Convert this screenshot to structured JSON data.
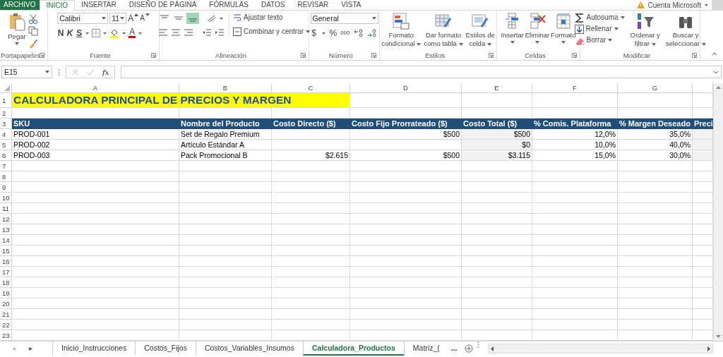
{
  "ribbon": {
    "tabs": [
      {
        "label": "ARCHIVO",
        "kind": "file",
        "selected": false
      },
      {
        "label": "INICIO",
        "kind": "tab",
        "selected": true
      },
      {
        "label": "INSERTAR",
        "kind": "tab",
        "selected": false
      },
      {
        "label": "DISEÑO DE PÁGINA",
        "kind": "tab",
        "selected": false
      },
      {
        "label": "FÓRMULAS",
        "kind": "tab",
        "selected": false
      },
      {
        "label": "DATOS",
        "kind": "tab",
        "selected": false
      },
      {
        "label": "REVISAR",
        "kind": "tab",
        "selected": false
      },
      {
        "label": "VISTA",
        "kind": "tab",
        "selected": false
      }
    ],
    "account": "Cuenta Microsoft",
    "clipboard": {
      "label": "Portapapeles",
      "paste": "Pegar"
    },
    "font": {
      "label": "Fuente",
      "font_name": "Calibri",
      "font_size": "11",
      "grow": "A",
      "shrink": "A",
      "bold": "N",
      "italic": "K",
      "underline": "S",
      "font_color": "A"
    },
    "alignment": {
      "label": "Alineación",
      "vertical": [
        {
          "selected": false
        },
        {
          "selected": false
        },
        {
          "selected": true
        }
      ],
      "wrap": "Ajustar texto",
      "merge": "Combinar y centrar"
    },
    "number": {
      "label": "Número",
      "format": "General",
      "currency": "$",
      "percent": "%",
      "thousands": "000"
    },
    "styles": {
      "label": "Estilos",
      "buttons": [
        {
          "lines": [
            "Formato",
            "condicional"
          ]
        },
        {
          "lines": [
            "Dar formato",
            "como tabla"
          ]
        },
        {
          "lines": [
            "Estilos de",
            "celda"
          ]
        }
      ]
    },
    "cells": {
      "label": "Celdas",
      "buttons": [
        "Insertar",
        "Eliminar",
        "Formato"
      ]
    },
    "editing": {
      "label": "Modificar",
      "small": [
        "Autosuma",
        "Rellenar",
        "Borrar"
      ],
      "large": [
        {
          "lines": [
            "Ordenar y",
            "filtrar"
          ]
        },
        {
          "lines": [
            "Buscar y",
            "seleccionar"
          ]
        }
      ]
    }
  },
  "formula_bar": {
    "name_box": "E15",
    "function_symbol": "fx"
  },
  "sheet": {
    "columns": [
      {
        "letter": "A",
        "shaded": false
      },
      {
        "letter": "B",
        "shaded": false
      },
      {
        "letter": "C",
        "shaded": false
      },
      {
        "letter": "D",
        "shaded": false
      },
      {
        "letter": "E",
        "shaded": true
      },
      {
        "letter": "F",
        "shaded": false
      },
      {
        "letter": "G",
        "shaded": false
      },
      {
        "shaded": true
      }
    ],
    "rows": [
      {
        "number": "1",
        "kind": "title",
        "cells": [
          "CALCULADORA PRINCIPAL DE PRECIOS Y MARGEN"
        ]
      },
      {
        "number": "2",
        "kind": "blank"
      },
      {
        "number": "3",
        "kind": "header",
        "cells": [
          "SKU",
          "Nombre del Producto",
          "Costo Directo ($)",
          "Costo Fijo Prorrateado ($)",
          "Costo Total ($)",
          "% Comis. Plataforma",
          "% Margen Deseado",
          "Preci"
        ]
      },
      {
        "number": "4",
        "kind": "data",
        "cells": [
          "PROD-001",
          "Set de Regalo Premium",
          null,
          "$500",
          "$500",
          "12,0%",
          "35,0%",
          null
        ]
      },
      {
        "number": "5",
        "kind": "data",
        "cells": [
          "PROD-002",
          "Artículo Estándar A",
          null,
          null,
          "$0",
          "10,0%",
          "40,0%",
          null
        ]
      },
      {
        "number": "6",
        "kind": "data",
        "cells": [
          "PROD-003",
          "Pack Promocional B",
          "$2.615",
          "$500",
          "$3.115",
          "15,0%",
          "30,0%",
          null
        ]
      },
      {
        "number": "7",
        "kind": "blank"
      },
      {
        "number": "8",
        "kind": "blank"
      },
      {
        "number": "9",
        "kind": "blank"
      },
      {
        "number": "10",
        "kind": "blank"
      },
      {
        "number": "11",
        "kind": "blank"
      },
      {
        "number": "12",
        "kind": "blank"
      },
      {
        "number": "13",
        "kind": "blank"
      },
      {
        "number": "14",
        "kind": "blank"
      },
      {
        "number": "15",
        "kind": "blank"
      },
      {
        "number": "16",
        "kind": "blank"
      },
      {
        "number": "17",
        "kind": "blank"
      },
      {
        "number": "18",
        "kind": "blank"
      },
      {
        "number": "19",
        "kind": "blank"
      },
      {
        "number": "20",
        "kind": "blank"
      },
      {
        "number": "21",
        "kind": "blank"
      },
      {
        "number": "22",
        "kind": "blank"
      },
      {
        "number": "23",
        "kind": "blank"
      }
    ]
  },
  "sheet_tabs": {
    "nav": [
      {
        "glyph": "◂",
        "disabled": true
      },
      {
        "glyph": "▸",
        "disabled": false
      }
    ],
    "tabs": [
      {
        "label": "Inicio_Instrucciones",
        "selected": false
      },
      {
        "label": "Costos_Fijos",
        "selected": false
      },
      {
        "label": "Costos_Variables_Insumos",
        "selected": false
      },
      {
        "label": "Calculadora_Productos",
        "selected": true
      },
      {
        "label": "Matriz_(",
        "selected": false
      }
    ],
    "more": "..."
  }
}
